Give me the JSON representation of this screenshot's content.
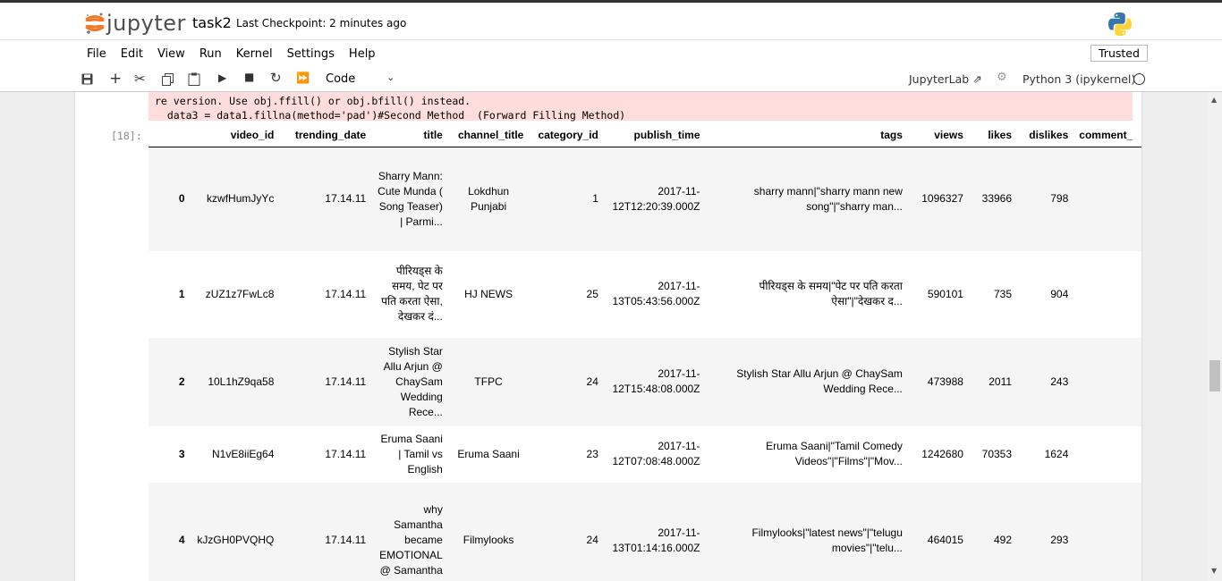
{
  "header": {
    "logo_text": "jupyter",
    "notebook_name": "task2",
    "checkpoint": "Last Checkpoint: 2 minutes ago"
  },
  "menu": [
    "File",
    "Edit",
    "View",
    "Run",
    "Kernel",
    "Settings",
    "Help"
  ],
  "trusted": "Trusted",
  "toolbar": {
    "cell_type": "Code",
    "jupyterlab": "JupyterLab",
    "kernel": "Python 3 (ipykernel)"
  },
  "output": {
    "stderr_line1": "re version. Use obj.ffill() or obj.bfill() instead.",
    "stderr_line2": "  data3 = data1.fillna(method='pad')#Second Method  (Forward Filling Method)",
    "prompt": "[18]:"
  },
  "table": {
    "columns": [
      "",
      "video_id",
      "trending_date",
      "title",
      "channel_title",
      "category_id",
      "publish_time",
      "tags",
      "views",
      "likes",
      "dislikes",
      "comment_"
    ],
    "rows": [
      {
        "idx": "0",
        "video_id": "kzwfHumJyYc",
        "trending_date": "17.14.11",
        "title": "Sharry Mann: Cute Munda ( Song Teaser) | Parmi...",
        "channel_title": "Lokdhun Punjabi",
        "category_id": "1",
        "publish_time": "2017-11-12T12:20:39.000Z",
        "tags": "sharry mann|\"sharry mann new song\"|\"sharry man...",
        "views": "1096327",
        "likes": "33966",
        "dislikes": "798"
      },
      {
        "idx": "1",
        "video_id": "zUZ1z7FwLc8",
        "trending_date": "17.14.11",
        "title": "पीरियड्स के समय, पेट पर पति करता ऐसा, देखकर दं...",
        "channel_title": "HJ NEWS",
        "category_id": "25",
        "publish_time": "2017-11-13T05:43:56.000Z",
        "tags": "पीरियड्स के समय|\"पेट पर पति करता ऐसा\"|\"देखकर द...",
        "views": "590101",
        "likes": "735",
        "dislikes": "904"
      },
      {
        "idx": "2",
        "video_id": "10L1hZ9qa58",
        "trending_date": "17.14.11",
        "title": "Stylish Star Allu Arjun @ ChaySam Wedding Rece...",
        "channel_title": "TFPC",
        "category_id": "24",
        "publish_time": "2017-11-12T15:48:08.000Z",
        "tags": "Stylish Star Allu Arjun @ ChaySam Wedding Rece...",
        "views": "473988",
        "likes": "2011",
        "dislikes": "243"
      },
      {
        "idx": "3",
        "video_id": "N1vE8iiEg64",
        "trending_date": "17.14.11",
        "title": "Eruma Saani | Tamil vs English",
        "channel_title": "Eruma Saani",
        "category_id": "23",
        "publish_time": "2017-11-12T07:08:48.000Z",
        "tags": "Eruma Saani|\"Tamil Comedy Videos\"|\"Films\"|\"Mov...",
        "views": "1242680",
        "likes": "70353",
        "dislikes": "1624"
      },
      {
        "idx": "4",
        "video_id": "kJzGH0PVQHQ",
        "trending_date": "17.14.11",
        "title": "why Samantha became EMOTIONAL @ Samantha",
        "channel_title": "Filmylooks",
        "category_id": "24",
        "publish_time": "2017-11-13T01:14:16.000Z",
        "tags": "Filmylooks|\"latest news\"|\"telugu movies\"|\"telu...",
        "views": "464015",
        "likes": "492",
        "dislikes": "293"
      }
    ]
  }
}
